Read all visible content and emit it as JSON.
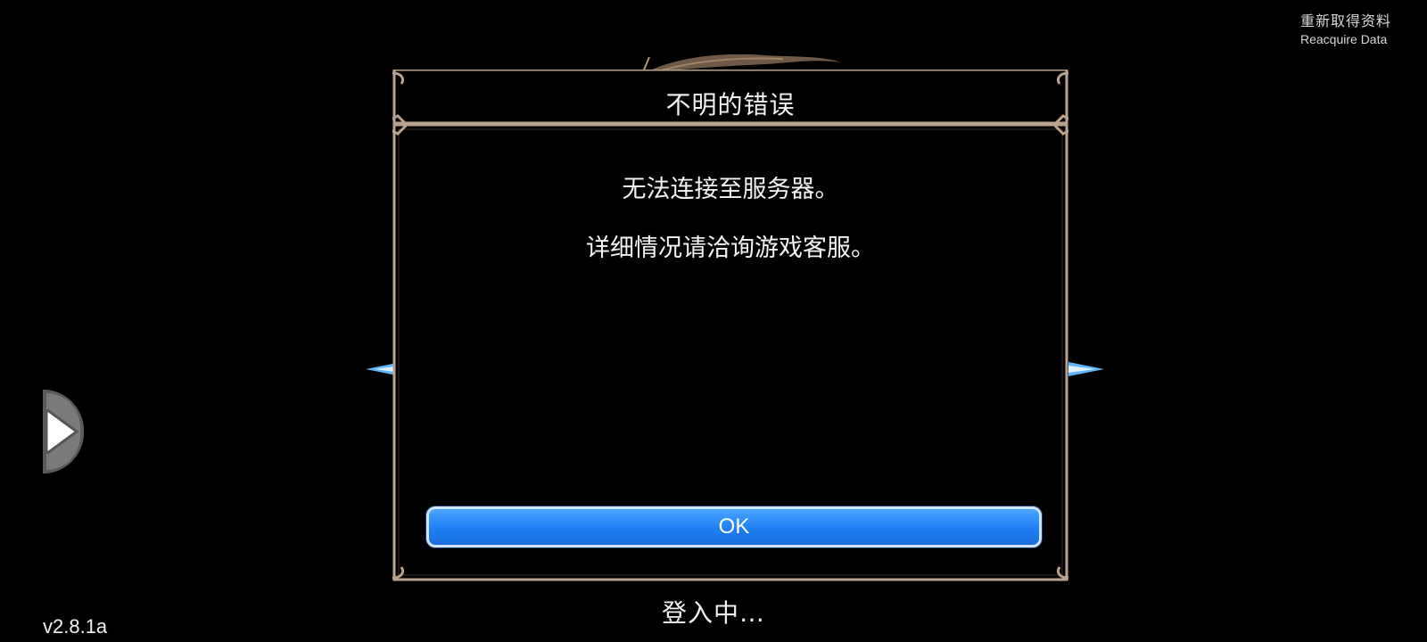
{
  "top_right": {
    "reacquire_zh": "重新取得资料",
    "reacquire_en": "Reacquire Data"
  },
  "dialog": {
    "title": "不明的错误",
    "message_lines": [
      "无法连接至服务器。",
      "详细情况请洽询游戏客服。"
    ],
    "ok_label": "OK"
  },
  "status_text": "登入中…",
  "version": "v2.8.1a",
  "colors": {
    "background": "#000000",
    "frame": "#b9a38f",
    "button": "#1e7ef2",
    "glow": "#5fb4ff"
  },
  "icons": {
    "side_handle": "play-icon",
    "ornament": "feather-ornament"
  }
}
